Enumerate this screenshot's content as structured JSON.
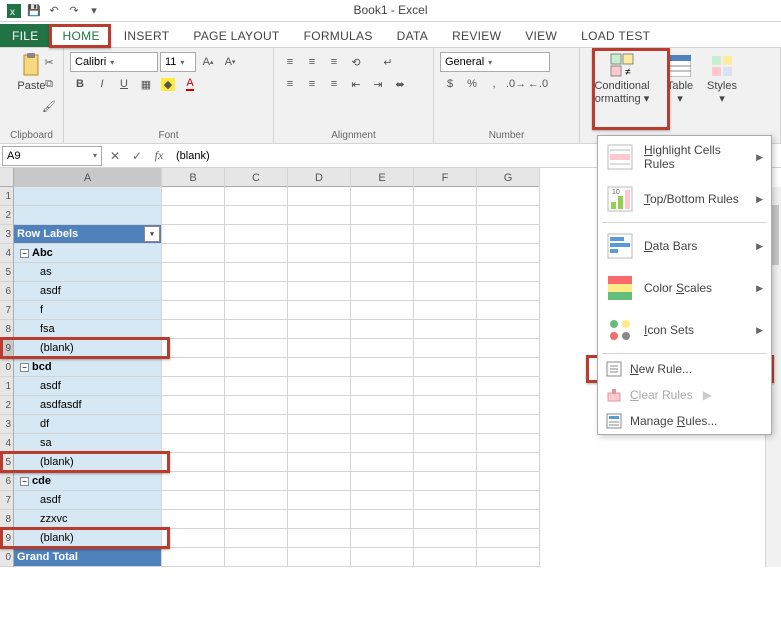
{
  "app": {
    "title": "Book1 - Excel"
  },
  "tabs": {
    "file": "FILE",
    "home": "HOME",
    "insert": "INSERT",
    "page_layout": "PAGE LAYOUT",
    "formulas": "FORMULAS",
    "data": "DATA",
    "review": "REVIEW",
    "view": "VIEW",
    "load_test": "LOAD TEST"
  },
  "ribbon": {
    "clipboard": {
      "label": "Clipboard",
      "paste": "Paste"
    },
    "font": {
      "label": "Font",
      "name": "Calibri",
      "size": "11"
    },
    "alignment": {
      "label": "Alignment"
    },
    "number": {
      "label": "Number",
      "format": "General"
    },
    "styles": {
      "label": "Styles",
      "conditional": "Conditional",
      "formatting": "ormatting",
      "table": "Table",
      "styles_btn": "Styles"
    }
  },
  "formula_bar": {
    "cell_ref": "A9",
    "value": "(blank)"
  },
  "columns": [
    "A",
    "B",
    "C",
    "D",
    "E",
    "F",
    "G"
  ],
  "rows": [
    {
      "n": "1",
      "a": ""
    },
    {
      "n": "2",
      "a": ""
    },
    {
      "n": "3",
      "a": "Row Labels",
      "header": true
    },
    {
      "n": "4",
      "a": "Abc",
      "group": true
    },
    {
      "n": "5",
      "a": "as",
      "indent": true
    },
    {
      "n": "6",
      "a": "asdf",
      "indent": true
    },
    {
      "n": "7",
      "a": "f",
      "indent": true
    },
    {
      "n": "8",
      "a": "fsa",
      "indent": true
    },
    {
      "n": "9",
      "a": "(blank)",
      "indent": true,
      "hl": true,
      "active": true
    },
    {
      "n": "0",
      "a": "bcd",
      "group": true
    },
    {
      "n": "1",
      "a": "asdf",
      "indent": true
    },
    {
      "n": "2",
      "a": "asdfasdf",
      "indent": true
    },
    {
      "n": "3",
      "a": "df",
      "indent": true
    },
    {
      "n": "4",
      "a": "sa",
      "indent": true
    },
    {
      "n": "5",
      "a": "(blank)",
      "indent": true,
      "hl": true
    },
    {
      "n": "6",
      "a": "cde",
      "group": true
    },
    {
      "n": "7",
      "a": "asdf",
      "indent": true
    },
    {
      "n": "8",
      "a": "zzxvc",
      "indent": true
    },
    {
      "n": "9",
      "a": "(blank)",
      "indent": true,
      "hl": true
    },
    {
      "n": "0",
      "a": "Grand Total",
      "footer": true
    }
  ],
  "cf_menu": {
    "highlight": "Highlight Cells Rules",
    "topbottom": "Top/Bottom Rules",
    "databars": "Data Bars",
    "colorscales": "Color Scales",
    "iconsets": "Icon Sets",
    "newrule": "New Rule...",
    "clear": "Clear Rules",
    "manage": "Manage Rules..."
  }
}
